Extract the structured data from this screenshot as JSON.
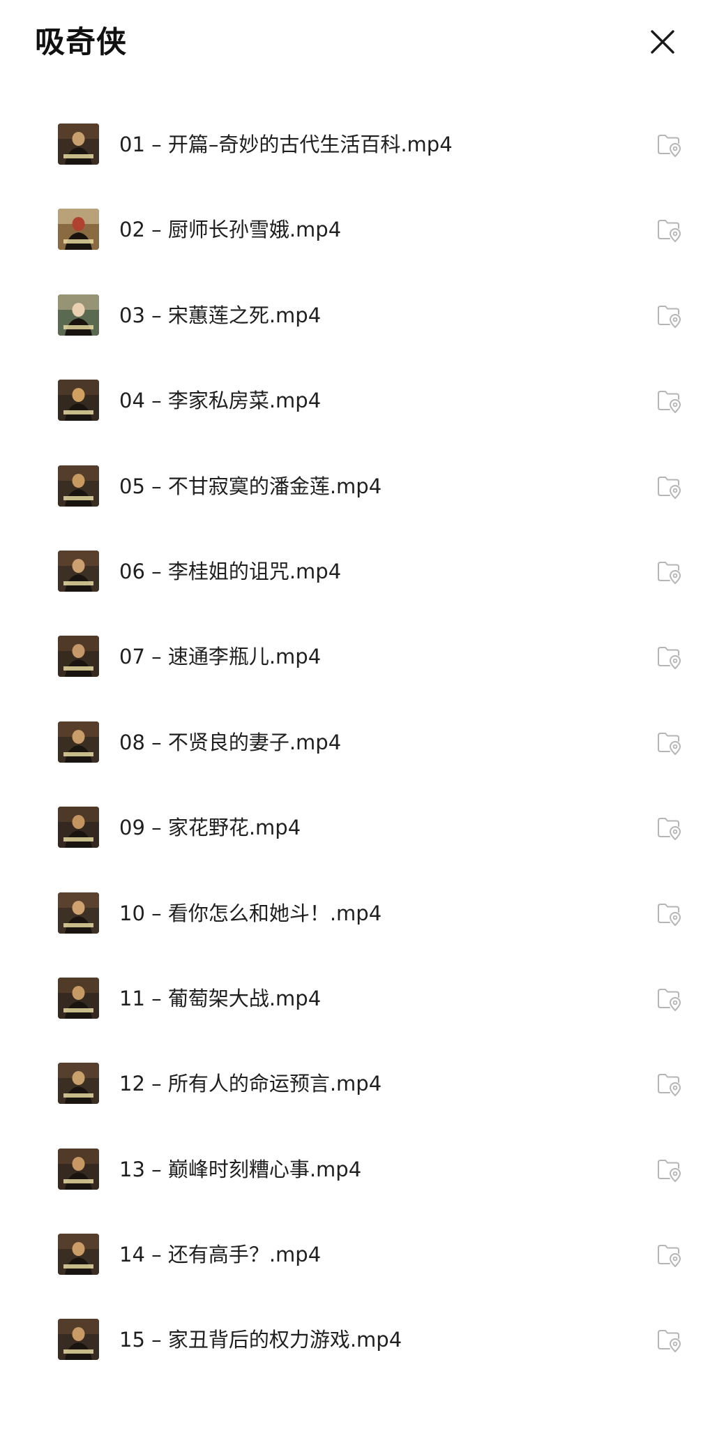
{
  "header": {
    "title": "吸奇侠",
    "close_icon": "close-icon"
  },
  "files": [
    {
      "name": "01 – 开篇–奇妙的古代生活百科.mp4",
      "thumb": "video-thumbnail-icon",
      "action_icon": "folder-location-icon"
    },
    {
      "name": "02 – 厨师长孙雪娥.mp4",
      "thumb": "video-thumbnail-icon",
      "action_icon": "folder-location-icon"
    },
    {
      "name": "03 – 宋蕙莲之死.mp4",
      "thumb": "video-thumbnail-icon",
      "action_icon": "folder-location-icon"
    },
    {
      "name": "04 – 李家私房菜.mp4",
      "thumb": "video-thumbnail-icon",
      "action_icon": "folder-location-icon"
    },
    {
      "name": "05 – 不甘寂寞的潘金莲.mp4",
      "thumb": "video-thumbnail-icon",
      "action_icon": "folder-location-icon"
    },
    {
      "name": "06 – 李桂姐的诅咒.mp4",
      "thumb": "video-thumbnail-icon",
      "action_icon": "folder-location-icon"
    },
    {
      "name": "07 – 速通李瓶儿.mp4",
      "thumb": "video-thumbnail-icon",
      "action_icon": "folder-location-icon"
    },
    {
      "name": "08 – 不贤良的妻子.mp4",
      "thumb": "video-thumbnail-icon",
      "action_icon": "folder-location-icon"
    },
    {
      "name": "09 – 家花野花.mp4",
      "thumb": "video-thumbnail-icon",
      "action_icon": "folder-location-icon"
    },
    {
      "name": "10 – 看你怎么和她斗！.mp4",
      "thumb": "video-thumbnail-icon",
      "action_icon": "folder-location-icon"
    },
    {
      "name": "11 – 葡萄架大战.mp4",
      "thumb": "video-thumbnail-icon",
      "action_icon": "folder-location-icon"
    },
    {
      "name": "12 – 所有人的命运预言.mp4",
      "thumb": "video-thumbnail-icon",
      "action_icon": "folder-location-icon"
    },
    {
      "name": "13 – 巅峰时刻糟心事.mp4",
      "thumb": "video-thumbnail-icon",
      "action_icon": "folder-location-icon"
    },
    {
      "name": "14 – 还有高手？.mp4",
      "thumb": "video-thumbnail-icon",
      "action_icon": "folder-location-icon"
    },
    {
      "name": "15 – 家丑背后的权力游戏.mp4",
      "thumb": "video-thumbnail-icon",
      "action_icon": "folder-location-icon"
    }
  ],
  "colors": {
    "text": "#1f1f1f",
    "icon_gray": "#b5b5b5",
    "background": "#ffffff"
  }
}
